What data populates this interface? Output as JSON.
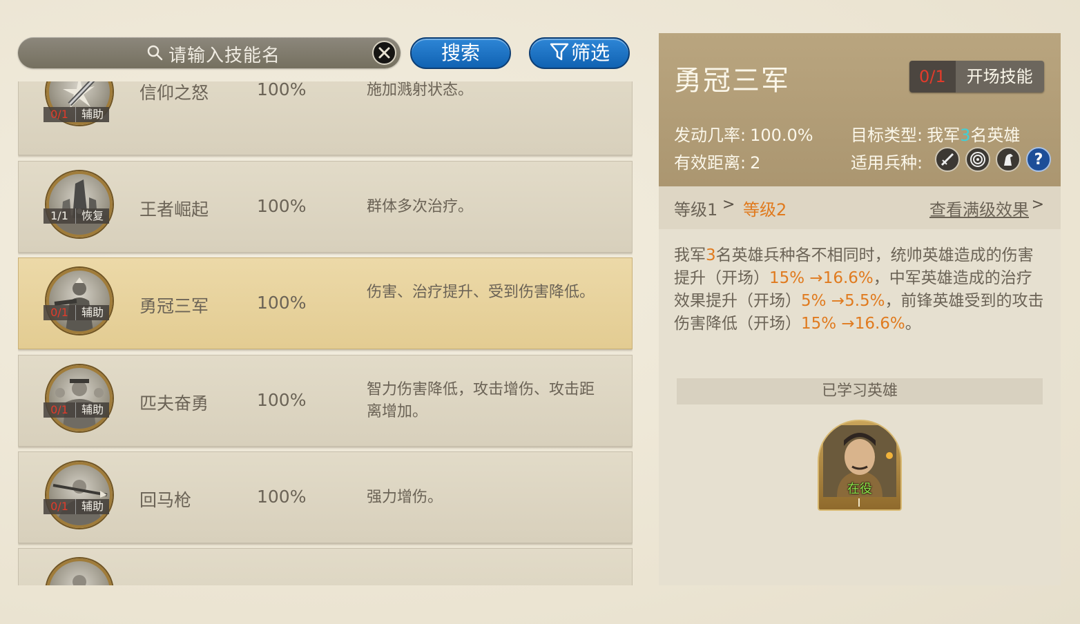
{
  "search": {
    "placeholder": "请输入技能名",
    "search_label": "搜索",
    "filter_label": "筛选"
  },
  "skills": [
    {
      "name": "信仰之怒",
      "chance": "100%",
      "desc": "施加溅射状态。",
      "count": "0/1",
      "type": "辅助",
      "selected": false
    },
    {
      "name": "王者崛起",
      "chance": "100%",
      "desc": "群体多次治疗。",
      "count": "1/1",
      "type": "恢复",
      "selected": false
    },
    {
      "name": "勇冠三军",
      "chance": "100%",
      "desc": "伤害、治疗提升、受到伤害降低。",
      "count": "0/1",
      "type": "辅助",
      "selected": true
    },
    {
      "name": "匹夫奋勇",
      "chance": "100%",
      "desc": "智力伤害降低，攻击增伤、攻击距离增加。",
      "count": "0/1",
      "type": "辅助",
      "selected": false
    },
    {
      "name": "回马枪",
      "chance": "100%",
      "desc": "强力增伤。",
      "count": "0/1",
      "type": "辅助",
      "selected": false
    }
  ],
  "detail": {
    "title": "勇冠三军",
    "tag_count": "0/1",
    "tag_label": "开场技能",
    "trigger_label": "发动几率:",
    "trigger_value": "100.0%",
    "range_label": "有效距离:",
    "range_value": "2",
    "target_label": "目标类型:",
    "target_pre": "我军",
    "target_num": "3",
    "target_post": "名英雄",
    "troop_label": "适用兵种:",
    "troop_icons": [
      "sword-icon",
      "target-icon",
      "horse-icon",
      "question-icon"
    ],
    "level1": "等级1",
    "level2": "等级2",
    "full_effect": "查看满级效果",
    "effect": {
      "p1": "我军",
      "n1": "3",
      "p2": "名英雄兵种各不相同时，统帅英雄造成的伤害提升（开场）",
      "v1": "15% →16.6%",
      "p3": "，中军英雄造成的治疗效果提升（开场）",
      "v2": "5% →5.5%",
      "p4": "，前锋英雄受到的攻击伤害降低（开场）",
      "v3": "15% →16.6%",
      "p5": "。"
    },
    "learned_header": "已学习英雄",
    "hero_status": "在役"
  },
  "colors": {
    "accent_orange": "#e07a1e",
    "count_red": "#e23b2b",
    "button_blue": "#1a6fc2",
    "highlight_cyan": "#3fd0d8"
  }
}
